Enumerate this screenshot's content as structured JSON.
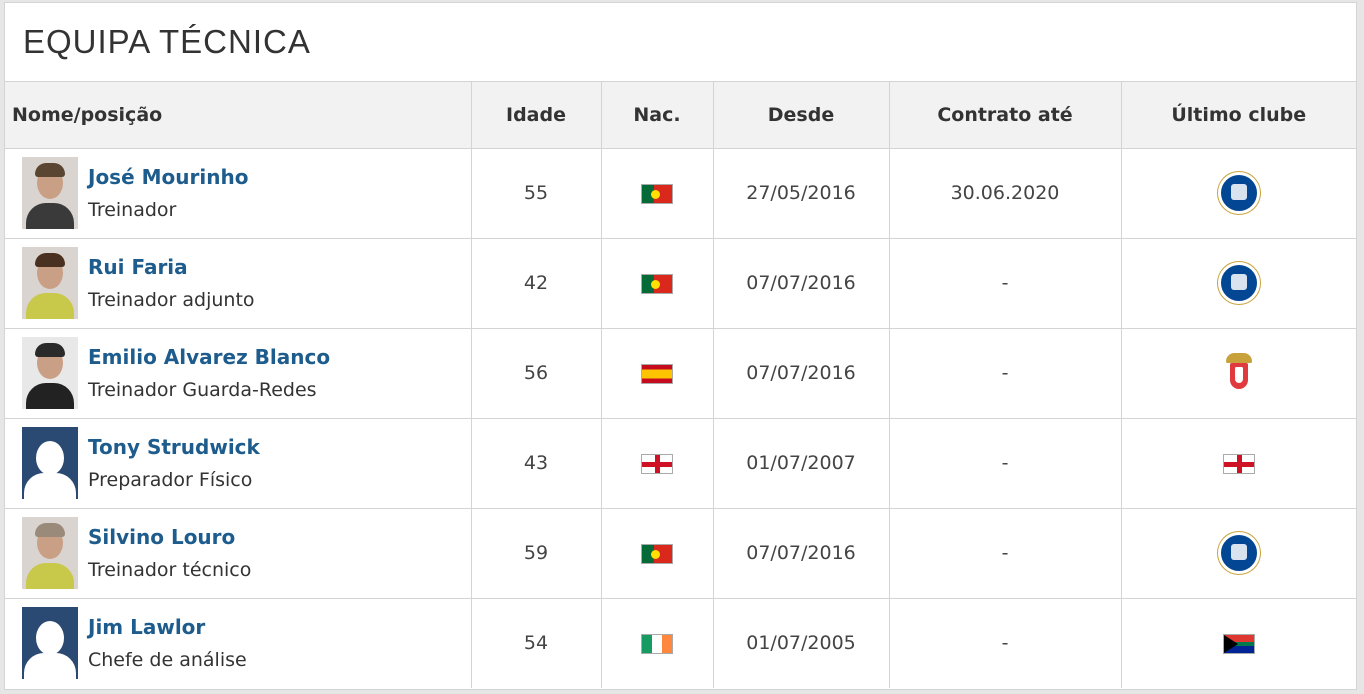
{
  "title": "EQUIPA TÉCNICA",
  "columns": {
    "name": "Nome/posição",
    "age": "Idade",
    "nat": "Nac.",
    "since": "Desde",
    "contract": "Contrato até",
    "last_club": "Último clube"
  },
  "rows": [
    {
      "name": "José Mourinho",
      "role": "Treinador",
      "age": "55",
      "nat_flag": "portugal-flag-icon",
      "since": "27/05/2016",
      "contract": "30.06.2020",
      "last_club_icon": "chelsea-crest-icon",
      "photo": "photo"
    },
    {
      "name": "Rui Faria",
      "role": "Treinador adjunto",
      "age": "42",
      "nat_flag": "portugal-flag-icon",
      "since": "07/07/2016",
      "contract": "-",
      "last_club_icon": "chelsea-crest-icon",
      "photo": "photo"
    },
    {
      "name": "Emilio Alvarez Blanco",
      "role": "Treinador Guarda-Redes",
      "age": "56",
      "nat_flag": "spain-flag-icon",
      "since": "07/07/2016",
      "contract": "-",
      "last_club_icon": "benfica-crest-icon",
      "photo": "photo"
    },
    {
      "name": "Tony Strudwick",
      "role": "Preparador Físico",
      "age": "43",
      "nat_flag": "england-flag-icon",
      "since": "01/07/2007",
      "contract": "-",
      "last_club_icon": "england-flag-icon",
      "photo": "silhouette"
    },
    {
      "name": "Silvino Louro",
      "role": "Treinador técnico",
      "age": "59",
      "nat_flag": "portugal-flag-icon",
      "since": "07/07/2016",
      "contract": "-",
      "last_club_icon": "chelsea-crest-icon",
      "photo": "photo"
    },
    {
      "name": "Jim Lawlor",
      "role": "Chefe de análise",
      "age": "54",
      "nat_flag": "ireland-flag-icon",
      "since": "01/07/2005",
      "contract": "-",
      "last_club_icon": "south-africa-flag-icon",
      "photo": "silhouette"
    }
  ],
  "colors": {
    "link": "#1d5c8c",
    "header_bg": "#f2f2f2",
    "border": "#d4d4d4"
  }
}
